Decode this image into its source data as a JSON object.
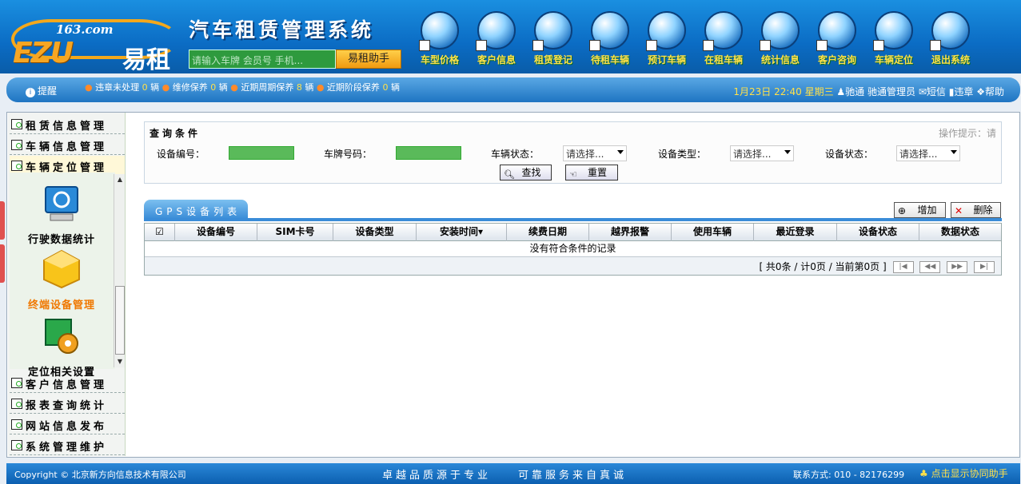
{
  "header": {
    "logo_top": "163.com",
    "logo_ezu": "EZU",
    "logo_name": "易租",
    "title": "汽车租赁管理系统",
    "search_placeholder": "请输入车牌 会员号 手机...",
    "helper_label": "易租助手"
  },
  "nav": [
    {
      "label": "车型价格",
      "icon": "car-price-icon"
    },
    {
      "label": "客户信息",
      "icon": "customer-info-icon"
    },
    {
      "label": "租赁登记",
      "icon": "lease-register-icon"
    },
    {
      "label": "待租车辆",
      "icon": "available-car-icon"
    },
    {
      "label": "预订车辆",
      "icon": "reserved-car-icon"
    },
    {
      "label": "在租车辆",
      "icon": "rented-car-icon"
    },
    {
      "label": "统计信息",
      "icon": "statistics-icon"
    },
    {
      "label": "客户咨询",
      "icon": "consult-icon"
    },
    {
      "label": "车辆定位",
      "icon": "locate-icon"
    },
    {
      "label": "退出系统",
      "icon": "exit-icon"
    }
  ],
  "notice": {
    "reminder": "提醒",
    "items": [
      {
        "label": "违章未处理",
        "count": "0",
        "unit": "辆"
      },
      {
        "label": "维修保养",
        "count": "0",
        "unit": "辆"
      },
      {
        "label": "近期周期保养",
        "count": "8",
        "unit": "辆"
      },
      {
        "label": "近期阶段保养",
        "count": "0",
        "unit": "辆"
      }
    ],
    "date": "1月23日",
    "time": "22:40",
    "weekday": "星期三",
    "company": "驰通",
    "user": "驰通管理员",
    "sms": "短信",
    "violation": "违章",
    "help": "帮助"
  },
  "sidebar": {
    "menus_top": [
      "租赁信息管理",
      "车辆信息管理",
      "车辆定位管理"
    ],
    "sub": [
      {
        "label": "行驶数据统计"
      },
      {
        "label": "终端设备管理"
      },
      {
        "label": "定位相关设置"
      }
    ],
    "menus_bottom": [
      "客户信息管理",
      "报表查询统计",
      "网站信息发布",
      "系统管理维护"
    ]
  },
  "query": {
    "title": "查询条件",
    "hint": "操作提示：请",
    "device_no": "设备编号：",
    "plate": "车牌号码：",
    "car_status": "车辆状态：",
    "device_type": "设备类型：",
    "device_status": "设备状态：",
    "select_placeholder": "请选择...",
    "search_btn": "查找",
    "reset_btn": "重置"
  },
  "list": {
    "tab": "GPS设备列表",
    "add": "增加",
    "delete": "删除",
    "columns": [
      "设备编号",
      "SIM卡号",
      "设备类型",
      "安装时间▾",
      "续费日期",
      "越界报警",
      "使用车辆",
      "最近登录",
      "设备状态",
      "数据状态"
    ],
    "empty": "没有符合条件的记录",
    "pager": "[ 共0条 / 计0页 / 当前第0页 ]",
    "pager_buttons": [
      "|◀",
      "◀◀",
      "▶▶",
      "▶|"
    ]
  },
  "footer": {
    "copyright": "Copyright © 北京新方向信息技术有限公司",
    "motto": "卓越品质源于专业　　可靠服务来自真诚",
    "contact": "联系方式: 010 - 82176299",
    "assist": "点击显示协同助手"
  }
}
